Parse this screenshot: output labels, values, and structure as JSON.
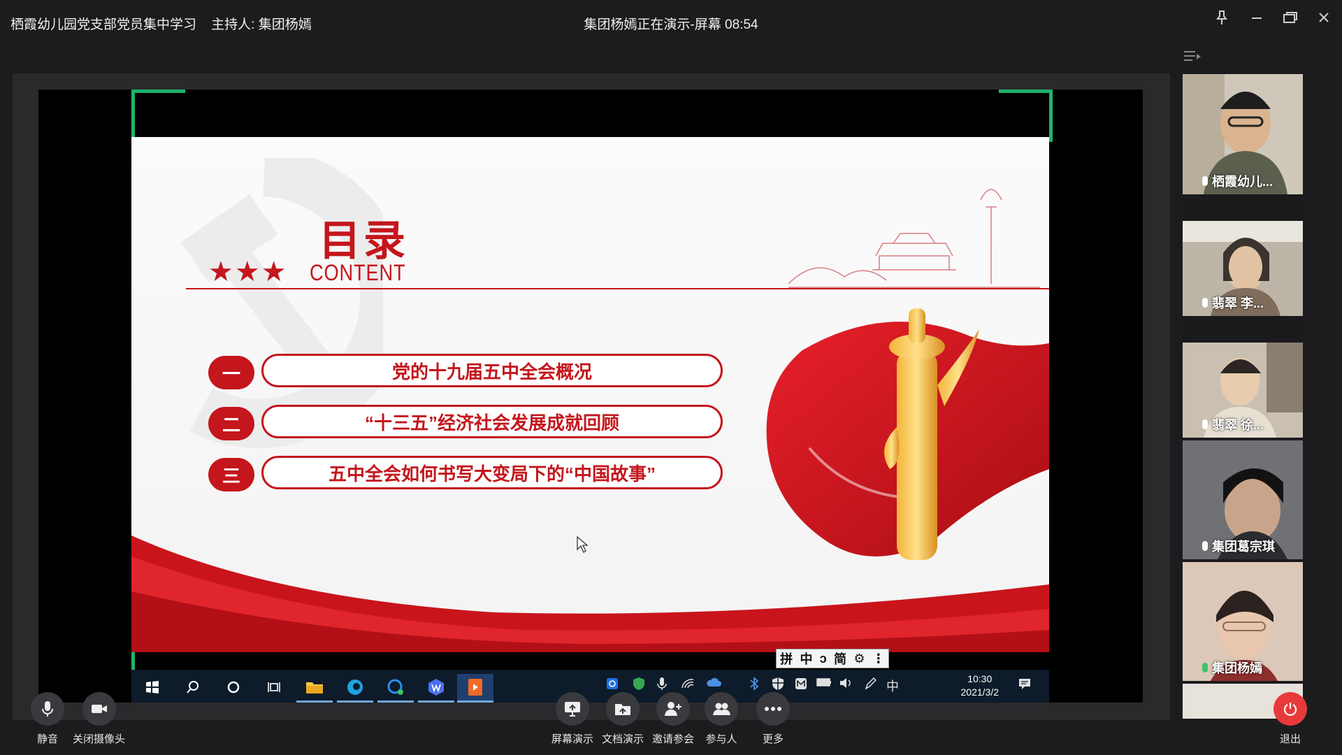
{
  "titlebar": {
    "meeting_title": "栖霞幼儿园党支部党员集中学习",
    "host_label": "主持人: 集团杨嫣",
    "presenter_status": "集团杨嫣正在演示-屏幕 08:54"
  },
  "slide": {
    "title": "目录",
    "subtitle": "CONTENT",
    "stars": "★★★",
    "items": [
      {
        "num": "一",
        "text": "党的十九届五中全会概况"
      },
      {
        "num": "二",
        "text": "“十三五”经济社会发展成就回顾"
      },
      {
        "num": "三",
        "text": "五中全会如何书写大变局下的“中国故事”"
      }
    ]
  },
  "taskbar": {
    "time": "10:30",
    "date": "2021/3/2",
    "ime": "中",
    "ime_bar": [
      "拼",
      "中",
      "ↄ",
      "简",
      "⚙",
      "⋮"
    ]
  },
  "participants": [
    {
      "name": "栖霞幼儿...",
      "color": "#c8c1b0"
    },
    {
      "name": "翡翠 李...",
      "color": "#bdb5a8"
    },
    {
      "name": "翡翠 徐...",
      "color": "#c9c0b2"
    },
    {
      "name": "集团葛宗琪",
      "color": "#6f7175"
    },
    {
      "name": "集团杨嫣",
      "color": "#d9c3b3"
    }
  ],
  "controls": {
    "mute": "静音",
    "camera_off": "关闭摄像头",
    "screen_share": "屏幕演示",
    "doc_share": "文档演示",
    "invite": "邀请参会",
    "participants": "参与人",
    "more": "更多",
    "exit": "退出"
  }
}
